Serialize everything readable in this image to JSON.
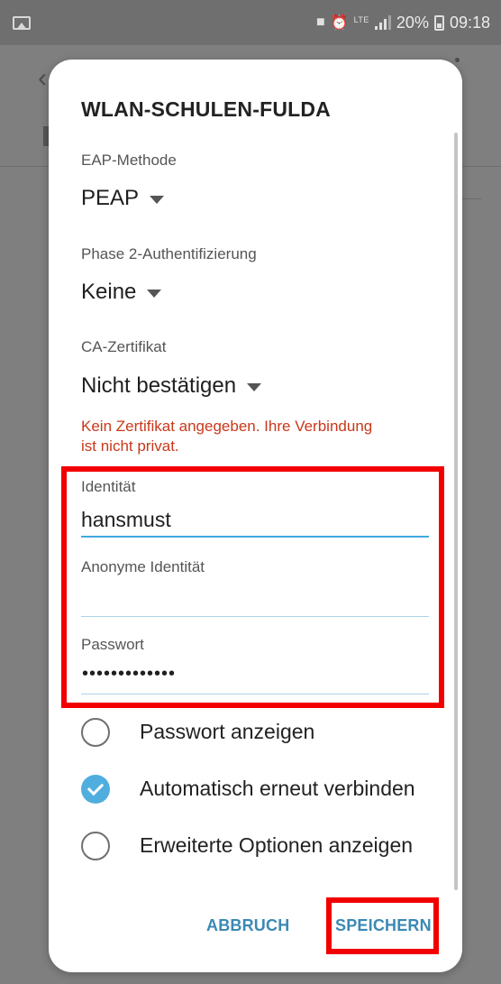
{
  "status_bar": {
    "network": "LTE",
    "battery": "20%",
    "time": "09:18"
  },
  "dialog": {
    "title": "WLAN-SCHULEN-FULDA",
    "eap_method": {
      "label": "EAP-Methode",
      "value": "PEAP"
    },
    "phase2": {
      "label": "Phase 2-Authentifizierung",
      "value": "Keine"
    },
    "ca_certificate": {
      "label": "CA-Zertifikat",
      "value": "Nicht bestätigen"
    },
    "warning_line1": "Kein Zertifikat angegeben. Ihre Verbindung",
    "warning_line2": "ist nicht privat.",
    "identity": {
      "label": "Identität",
      "value": "hansmust"
    },
    "anonymous_identity": {
      "label": "Anonyme Identität",
      "value": ""
    },
    "password": {
      "label": "Passwort",
      "value": "•••••••••••••"
    },
    "options": [
      {
        "label": "Passwort anzeigen",
        "checked": false
      },
      {
        "label": "Automatisch erneut verbinden",
        "checked": true
      },
      {
        "label": "Erweiterte Optionen anzeigen",
        "checked": false
      }
    ],
    "buttons": {
      "cancel": "ABBRUCH",
      "save": "SPEICHERN"
    }
  },
  "colors": {
    "accent": "#3fa9e0",
    "button_text": "#3b89b4",
    "warning": "#c9381a",
    "highlight": "#f20000",
    "overlay": "#7f7f7f"
  }
}
